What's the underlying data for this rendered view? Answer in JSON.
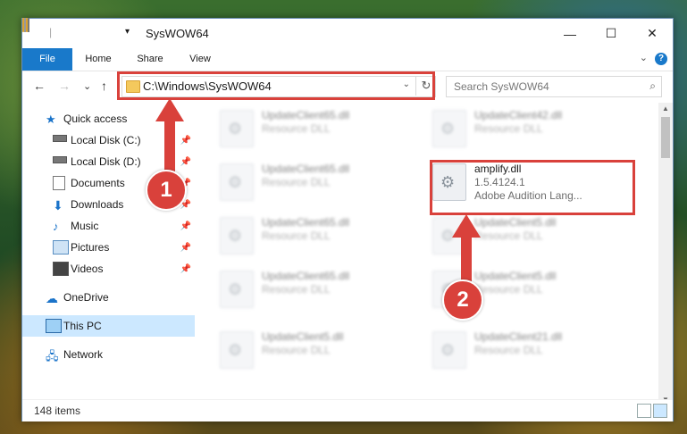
{
  "window": {
    "title": "SysWOW64",
    "controls": {
      "minimize": "—",
      "maximize": "☐",
      "close": "✕"
    }
  },
  "ribbon": {
    "tabs": [
      "File",
      "Home",
      "Share",
      "View"
    ],
    "help": "?"
  },
  "address": {
    "back": "←",
    "forward": "→",
    "recent": "⌄",
    "up": "↑",
    "path": "C:\\Windows\\SysWOW64",
    "refresh": "↻",
    "search_placeholder": "Search SysWOW64"
  },
  "sidebar": {
    "items": [
      {
        "label": "Quick access",
        "icon": "star-icon"
      },
      {
        "label": "Local Disk (C:)",
        "icon": "drive-icon",
        "pinned": true
      },
      {
        "label": "Local Disk (D:)",
        "icon": "drive-icon",
        "pinned": true
      },
      {
        "label": "Documents",
        "icon": "documents-icon",
        "pinned": true
      },
      {
        "label": "Downloads",
        "icon": "download-icon",
        "pinned": true
      },
      {
        "label": "Music",
        "icon": "music-icon",
        "pinned": true
      },
      {
        "label": "Pictures",
        "icon": "pictures-icon",
        "pinned": true
      },
      {
        "label": "Videos",
        "icon": "videos-icon",
        "pinned": true
      },
      {
        "label": "OneDrive",
        "icon": "cloud-icon"
      },
      {
        "label": "This PC",
        "icon": "computer-icon",
        "selected": true
      },
      {
        "label": "Network",
        "icon": "network-icon"
      }
    ]
  },
  "files": [
    {
      "name": "UpdateClient65.dll",
      "desc": "Resource DLL"
    },
    {
      "name": "UpdateClient42.dll",
      "desc": "Resource DLL"
    },
    {
      "name": "UpdateClient65.dll",
      "desc": "Resource DLL"
    },
    {
      "name": "amplify.dll",
      "version": "1.5.4124.1",
      "desc": "Adobe Audition Lang..."
    },
    {
      "name": "UpdateClient65.dll",
      "desc": "Resource DLL"
    },
    {
      "name": "UpdateClient5.dll",
      "desc": "Resource DLL"
    },
    {
      "name": "UpdateClient65.dll",
      "desc": "Resource DLL"
    },
    {
      "name": "UpdateClient5.dll",
      "desc": "Resource DLL"
    },
    {
      "name": "UpdateClient5.dll",
      "desc": "Resource DLL"
    },
    {
      "name": "UpdateClient21.dll",
      "desc": "Resource DLL"
    }
  ],
  "annotations": {
    "step1": "1",
    "step2": "2",
    "color": "#d9413b"
  },
  "status": {
    "count": "148 items"
  },
  "colors": {
    "accent": "#1979ca",
    "selection": "#cce8ff"
  }
}
